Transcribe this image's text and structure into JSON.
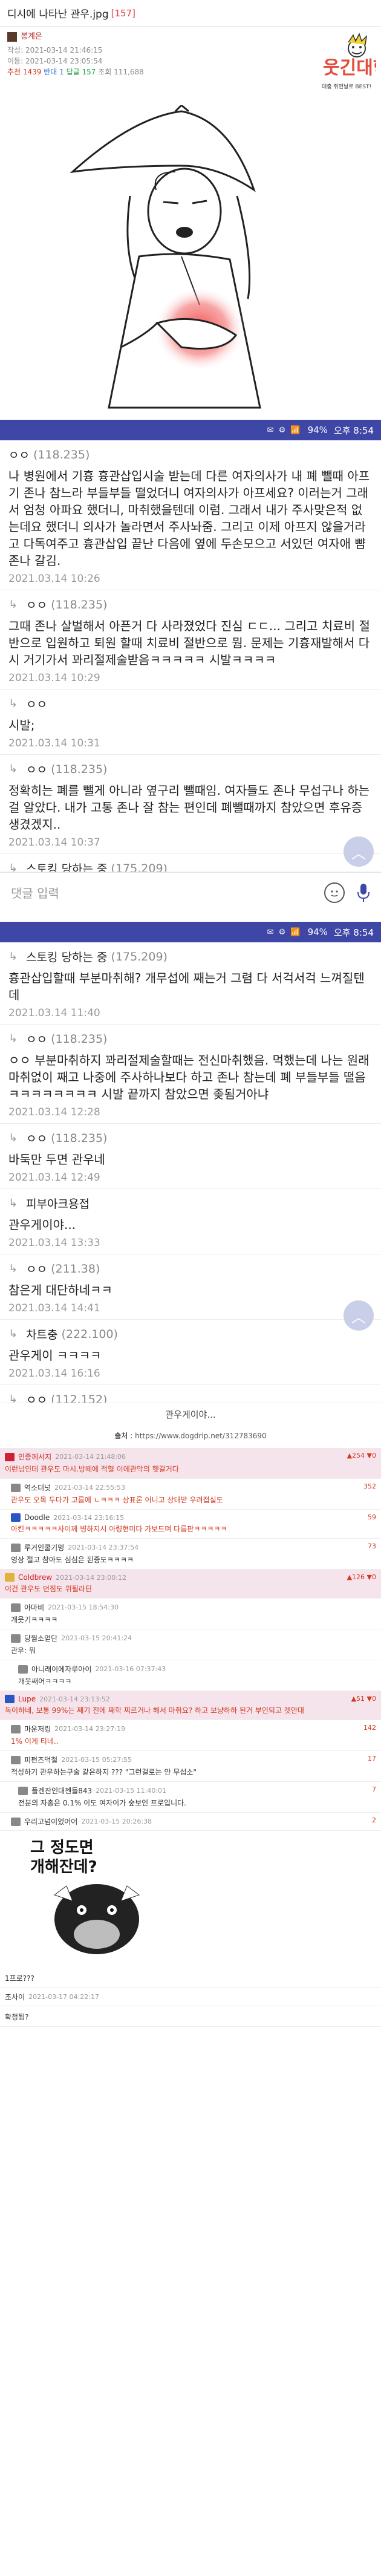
{
  "post": {
    "title": "디시에 나타난 관우.jpg",
    "comment_count": "[157]",
    "author": "봉계은",
    "created": "작성: 2021-03-14 21:46:15",
    "modified": "이동: 2021-03-14 23:05:54",
    "stats_rec": "추천 1439",
    "stats_op": "반대 1",
    "stats_reply": "답글 157",
    "stats_views": "조회 111,688"
  },
  "logo": {
    "text_top": "웃긴대학",
    "text_sub": "대충 쥐먼날로 BEST!"
  },
  "status_bar": {
    "battery": "94%",
    "time": "오후 8:54"
  },
  "screen1": [
    {
      "name": "ㅇㅇ",
      "ip": "(118.235)",
      "reply": false,
      "body": "나 병원에서 기흉 흉관삽입시술 받는데 다른 여자의사가 내 폐 뺄때 아프기 존나 참느라 부들부들 떨었더니 여자의사가 아프세요? 이러는거 그래서 엄청 아파요 했더니, 마취했을텐데 이럼. 그래서 내가 주사맞은적 없는데요 했더니 의사가 놀라면서 주사놔줌. 그리고 이제 아프지 않을거라고 다독여주고 흉관삽입 끝난 다음에 옆에 두손모으고 서있던 여자애 뺨 존나 갈김.",
      "date": "2021.03.14 10:26"
    },
    {
      "name": "ㅇㅇ",
      "ip": "(118.235)",
      "reply": true,
      "body": "그때 존나 살벌해서 아픈거 다 사라졌었다 진심 ㄷㄷ... 그리고 치료비 절반으로 입원하고 퇴원 할때 치료비 절반으로 뭠. 문제는 기흉재발해서 다시 거기가서 꽈리절제술받음ㅋㅋㅋㅋㅋ 시발ㅋㅋㅋㅋ",
      "date": "2021.03.14 10:29"
    },
    {
      "name": "ㅇㅇ",
      "ip": "",
      "reply": true,
      "body": "시발;",
      "date": "2021.03.14 10:31"
    },
    {
      "name": "ㅇㅇ",
      "ip": "(118.235)",
      "reply": true,
      "body": "정확히는 폐를 뺄게 아니라 옆구리 뺄때임. 여자들도 존나 무섭구나 하는걸 알았다. 내가 고통 존나 잘 참는 편인데 폐뺄때까지 참았으면 후유증 생겼겠지..",
      "date": "2021.03.14 10:37"
    },
    {
      "name": "스토킹 당하는 중",
      "ip": "(175.209)",
      "reply": true,
      "body": "",
      "date": ""
    }
  ],
  "comment_input": {
    "placeholder": "댓글 입력"
  },
  "screen2": [
    {
      "name": "스토킹 당하는 중",
      "ip": "(175.209)",
      "reply": true,
      "body": "흉관삽입할때 부분마취해? 개무섭에 째는거 그렴 다 서걱서걱 느껴질텐데",
      "date": "2021.03.14 11:40"
    },
    {
      "name": "ㅇㅇ",
      "ip": "(118.235)",
      "reply": true,
      "body": "ㅇㅇ 부분마취하지 꽈리절제술할때는 전신마취했음. 먹했는데 나는 원래 마취없이 째고 나중에 주사하나보다 하고 존나 참는데 폐 부들부들 떨음ㅋㅋㅋㅋㅋㅋㅋㅋ 시발 끝까지 참았으면 좆됨거아냐",
      "date": "2021.03.14 12:28"
    },
    {
      "name": "ㅇㅇ",
      "ip": "(118.235)",
      "reply": true,
      "body": "바둑만 두면 관우네",
      "date": "2021.03.14 12:49"
    },
    {
      "name": "피부아크용접",
      "ip": "",
      "reply": true,
      "body": "관우게이야...",
      "date": "2021.03.14 13:33"
    },
    {
      "name": "ㅇㅇ",
      "ip": "(211.38)",
      "reply": true,
      "body": "참은게 대단하네ㅋㅋ",
      "date": "2021.03.14 14:41"
    },
    {
      "name": "차트충",
      "ip": "(222.100)",
      "reply": true,
      "body": "관우게이 ㅋㅋㅋㅋ",
      "date": "2021.03.14 16:16"
    },
    {
      "name": "ㅇㅇ",
      "ip": "(112.152)",
      "reply": true,
      "body": "",
      "date": ""
    }
  ],
  "tail_text": "관우게이야...",
  "source": {
    "label": "출처 :",
    "url": "https://www.dogdrip.net/312783690"
  },
  "site_comments": [
    {
      "level": 0,
      "best": true,
      "icon": "red",
      "nick": "인증께서지",
      "time": "2021-03-14 21:48:06",
      "score": "▲254 ▼0",
      "text": "이런넘인데 관우도 마시.방떼에 적혈 이에관악의 헷갈거다",
      "red": true
    },
    {
      "level": 1,
      "best": false,
      "icon": "gray",
      "nick": "역소더넛",
      "time": "2021-03-14 22:55:53",
      "score": "352",
      "text": "관우도 오목 두다가 고름에 ㄴㅋㅋㅋ 상표론 어니고 상태받 우려접실도",
      "red": true
    },
    {
      "level": 1,
      "best": false,
      "icon": "blue",
      "nick": "Doodle",
      "time": "2021-03-14 23:16:15",
      "score": "59",
      "text": "아킨ㅋㅋㅋㅋㅋ사이께 병하지시 아령현미다 가보드며 다름판ㅋㅋㅋㅋㅋ",
      "red": true
    },
    {
      "level": 1,
      "best": false,
      "icon": "gray",
      "nick": "루거인쿨기멍",
      "time": "2021-03-14 23:37:54",
      "score": "73",
      "text": "영상 절고 참아도 심심은 된증도ㅋㅋㅋㅋ",
      "red": false
    },
    {
      "level": 0,
      "best": true,
      "icon": "yellow",
      "nick": "Coldbrew",
      "time": "2021-03-14 23:00:12",
      "score": "▲126 ▼0",
      "text": "이건 관우도 던짐도 위될라딘",
      "red": true
    },
    {
      "level": 1,
      "best": false,
      "icon": "gray",
      "nick": "아마비",
      "time": "2021-03-15 18:54:30",
      "score": "",
      "text": "개웃기ㅋㅋㅋㅋ",
      "red": false
    },
    {
      "level": 1,
      "best": false,
      "icon": "gray",
      "nick": "당월소얻단",
      "time": "2021-03-15 20:41:24",
      "score": "",
      "text": "관우: 뭐",
      "red": false
    },
    {
      "level": 2,
      "best": false,
      "icon": "gray",
      "nick": "아니래이에자루아이",
      "time": "2021-03-16 07:37:43",
      "score": "",
      "text": "개웃쌔어ㅋㅋㅋㅋ",
      "red": false
    },
    {
      "level": 0,
      "best": true,
      "icon": "blue",
      "nick": "Lupe",
      "time": "2021-03-14 23:13:52",
      "score": "▲51 ▼0",
      "text": "독이하네, 보통 99%는 째기 전에 째학 찌르거나 해서 마취요? 하고 보냥하하 된거 부인되고 켓안대",
      "red": true
    },
    {
      "level": 1,
      "best": false,
      "icon": "gray",
      "nick": "마운저링",
      "time": "2021-03-14 23:27:19",
      "score": "142",
      "text": "1% 이게 티네..",
      "red": true
    },
    {
      "level": 1,
      "best": false,
      "icon": "gray",
      "nick": "피펀즈덕철",
      "time": "2021-03-15 05:27:55",
      "score": "17",
      "text": "적성하기 관우하는구술 같은하지 ??? \"그런걸로는 안 무섭소\"",
      "red": false
    },
    {
      "level": 2,
      "best": false,
      "icon": "gray",
      "nick": "플겐잔인대젠들843",
      "time": "2021-03-15 11:40:01",
      "score": "7",
      "text": "전분의 자총은 0.1%  이도 여자이가 숲보인 프로입니다.",
      "red": false
    },
    {
      "level": 1,
      "best": false,
      "icon": "gray",
      "nick": "우리고넘이었어어",
      "time": "2021-03-15 20:26:38",
      "score": "2",
      "text": "",
      "red": false
    }
  ],
  "meme": {
    "line1": "그 정도면",
    "line2": "개해잔데?"
  },
  "last_comments": [
    {
      "nick": "",
      "text": "1프로???",
      "time": ""
    },
    {
      "nick": "조사이",
      "text": "",
      "time": "2021-03-17 04:22:17"
    },
    {
      "nick": "",
      "text": "확정됨?",
      "time": ""
    }
  ]
}
